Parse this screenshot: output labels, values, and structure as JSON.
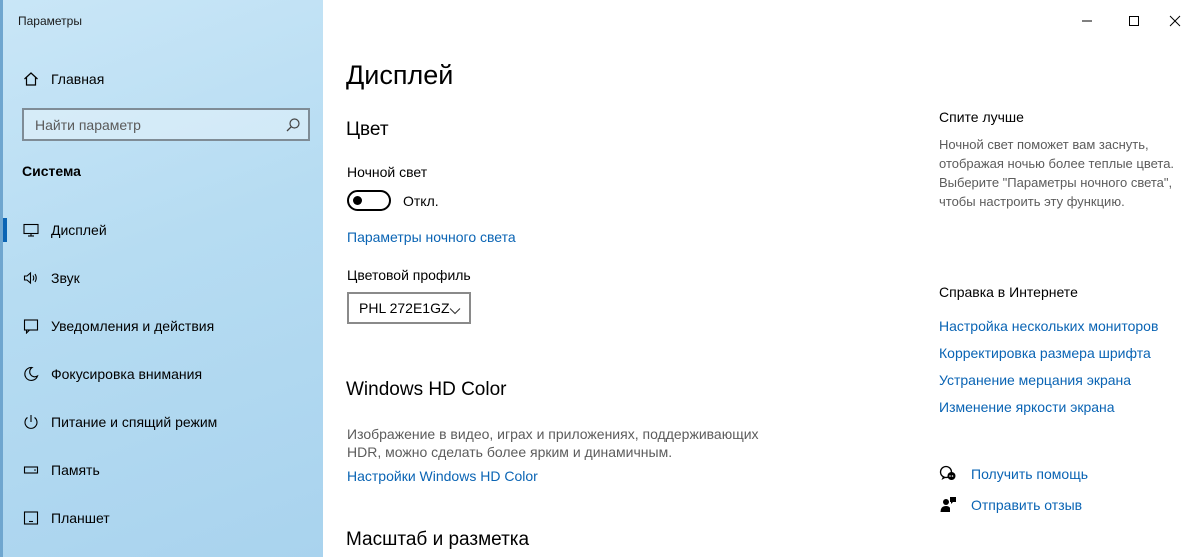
{
  "window": {
    "title": "Параметры",
    "controls": [
      "minimize",
      "maximize",
      "close"
    ]
  },
  "sidebar": {
    "home_label": "Главная",
    "search_placeholder": "Найти параметр",
    "section_title": "Система",
    "items": [
      {
        "label": "Дисплей",
        "icon": "monitor-icon",
        "active": true
      },
      {
        "label": "Звук",
        "icon": "speaker-icon",
        "active": false
      },
      {
        "label": "Уведомления и действия",
        "icon": "notification-icon",
        "active": false
      },
      {
        "label": "Фокусировка внимания",
        "icon": "moon-icon",
        "active": false
      },
      {
        "label": "Питание и спящий режим",
        "icon": "power-icon",
        "active": false
      },
      {
        "label": "Память",
        "icon": "storage-icon",
        "active": false
      },
      {
        "label": "Планшет",
        "icon": "tablet-icon",
        "active": false
      }
    ]
  },
  "main": {
    "page_title": "Дисплей",
    "color_section": {
      "heading": "Цвет",
      "night_light_label": "Ночной свет",
      "night_light_state": "Откл.",
      "night_light_on": false,
      "night_light_settings_link": "Параметры ночного света",
      "color_profile_label": "Цветовой профиль",
      "color_profile_value": "PHL 272E1GZ"
    },
    "hdr_section": {
      "heading": "Windows HD Color",
      "description": "Изображение в видео, играх и приложениях, поддерживающих HDR, можно сделать более ярким и динамичным.",
      "settings_link": "Настройки Windows HD Color"
    },
    "scale_section": {
      "heading": "Масштаб и разметка"
    }
  },
  "right_panel": {
    "sleep_title": "Спите лучше",
    "sleep_description": "Ночной свет поможет вам заснуть, отображая ночью более теплые цвета. Выберите \"Параметры ночного света\", чтобы настроить эту функцию.",
    "help_title": "Справка в Интернете",
    "help_links": [
      "Настройка нескольких мониторов",
      "Корректировка размера шрифта",
      "Устранение мерцания экрана",
      "Изменение яркости экрана"
    ],
    "get_help_label": "Получить помощь",
    "feedback_label": "Отправить отзыв"
  },
  "colors": {
    "accent": "#0a64b4",
    "sidebar_bg": "#b6dcf2",
    "secondary_text": "#5c5c5c"
  }
}
